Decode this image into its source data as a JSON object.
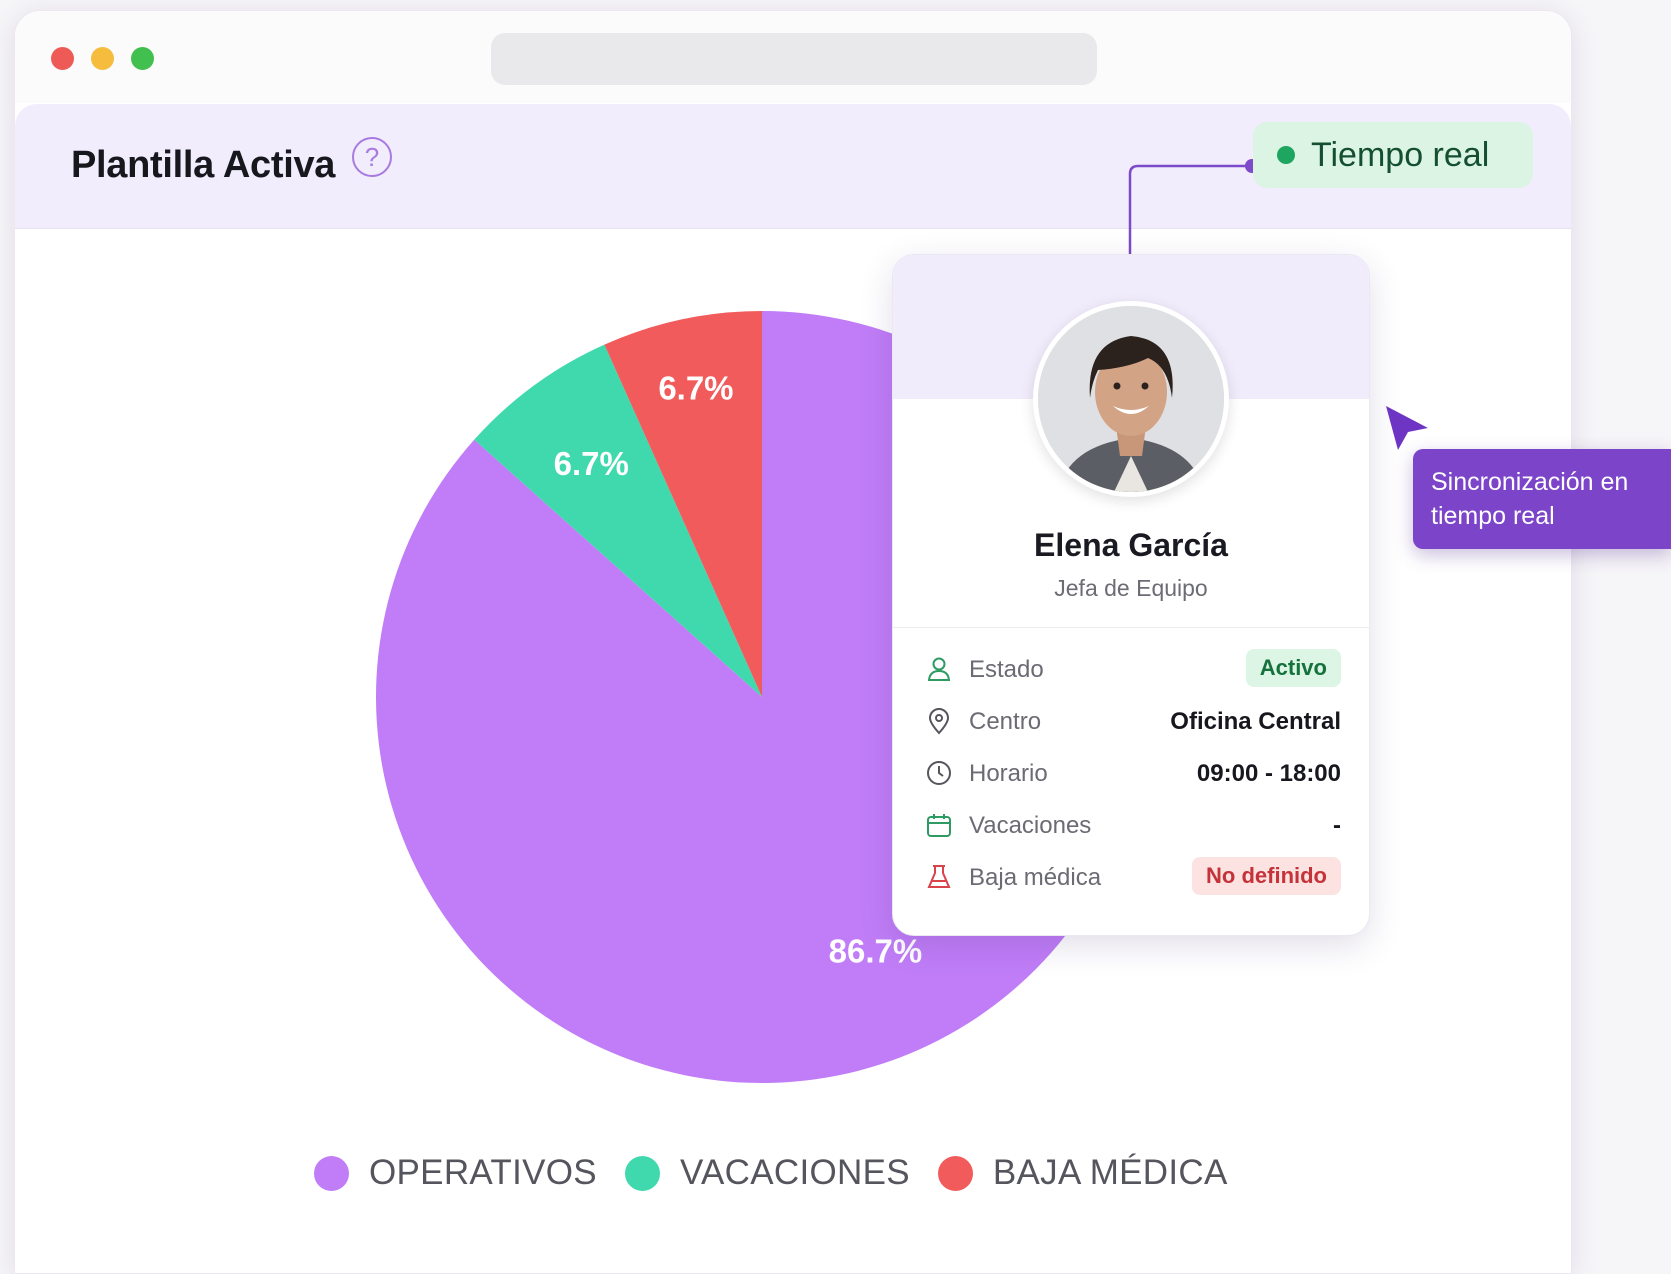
{
  "header": {
    "title": "Plantilla Activa",
    "help_icon": "question-circle-icon",
    "status_badge": "Tiempo real"
  },
  "chart_data": {
    "type": "pie",
    "categories": [
      "OPERATIVOS",
      "VACACIONES",
      "BAJA MÉDICA"
    ],
    "values": [
      86.7,
      6.7,
      6.7
    ],
    "labels": [
      "86.7%",
      "6.7%",
      "6.7%"
    ],
    "colors": [
      "#c07df7",
      "#40d9ad",
      "#f25b5b"
    ],
    "legend_position": "bottom"
  },
  "card": {
    "name": "Elena García",
    "role": "Jefa de Equipo",
    "rows": [
      {
        "icon": "user-icon",
        "label": "Estado",
        "value": "Activo"
      },
      {
        "icon": "location-pin-icon",
        "label": "Centro",
        "value": "Oficina Central"
      },
      {
        "icon": "clock-icon",
        "label": "Horario",
        "value": "09:00 - 18:00"
      },
      {
        "icon": "calendar-icon",
        "label": "Vacaciones",
        "value": "-"
      },
      {
        "icon": "medical-icon",
        "label": "Baja médica",
        "value": "No definido"
      }
    ]
  },
  "tooltip": {
    "text": "Sincronización en tiempo real"
  },
  "colors": {
    "accent": "#7b44c9",
    "header_bg": "#f2edfc",
    "badge_bg": "#dcf4e4",
    "badge_dot": "#1ea560"
  }
}
